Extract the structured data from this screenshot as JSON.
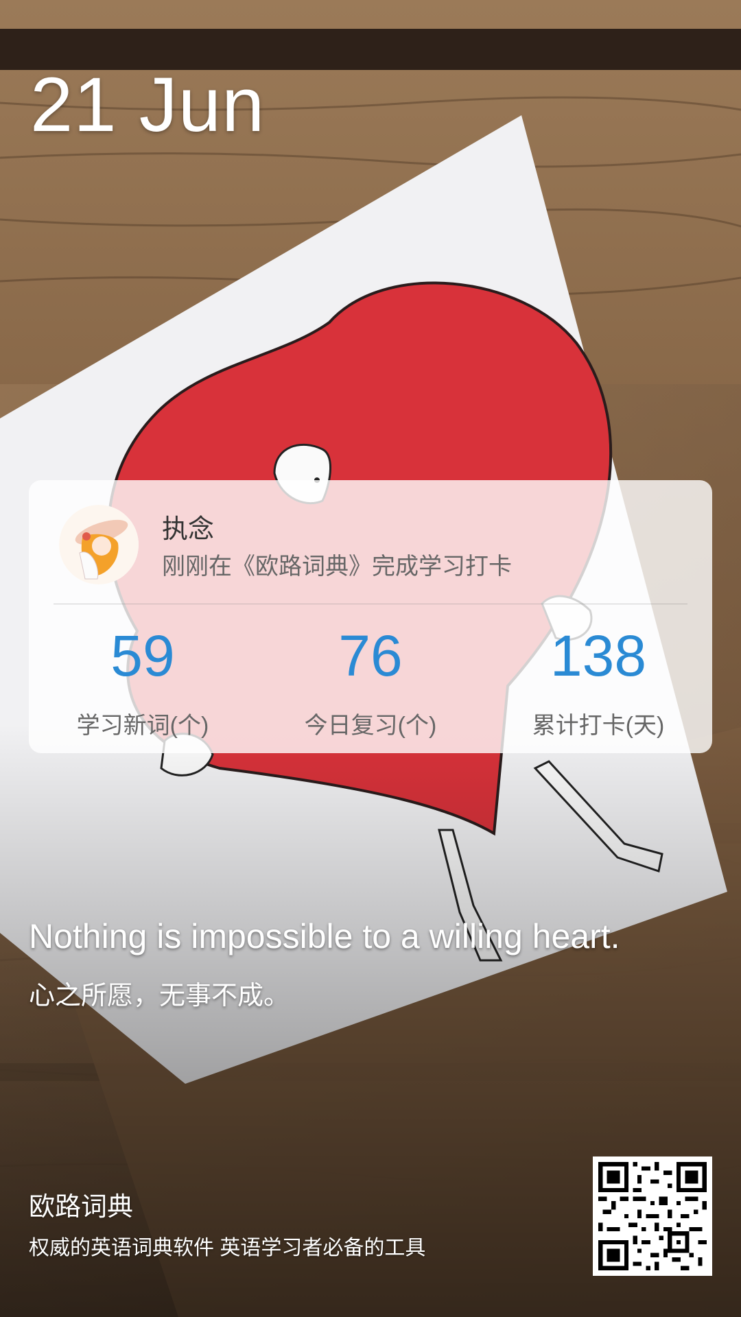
{
  "date": "21 Jun",
  "user": {
    "name": "执念",
    "status": "刚刚在《欧路词典》完成学习打卡"
  },
  "stats": [
    {
      "value": "59",
      "label": "学习新词(个)"
    },
    {
      "value": "76",
      "label": "今日复习(个)"
    },
    {
      "value": "138",
      "label": "累计打卡(天)"
    }
  ],
  "quote": {
    "en": "Nothing is impossible to a willing heart.",
    "cn": "心之所愿，无事不成。"
  },
  "footer": {
    "app_name": "欧路词典",
    "slogan": "权威的英语词典软件 英语学习者必备的工具"
  },
  "colors": {
    "accent": "#2a8ad4",
    "heart": "#d8323a",
    "wood": "#8a6a4a"
  },
  "icons": {
    "avatar": "anime-girl-avatar",
    "qr": "qr-code-icon"
  }
}
